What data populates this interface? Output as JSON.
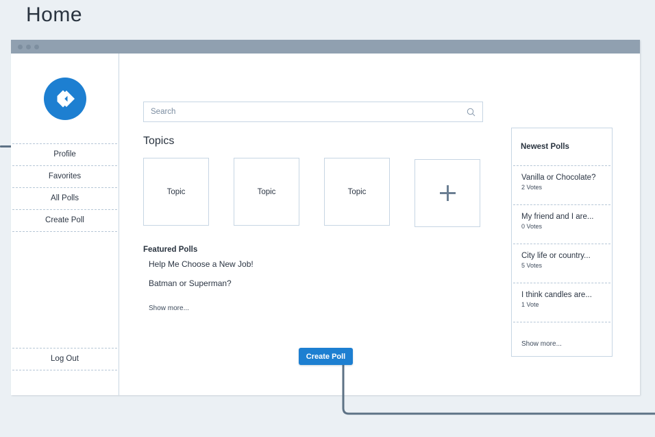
{
  "page": {
    "title": "Home",
    "background_color": "#ebf0f4",
    "accent_color": "#1d7fd1"
  },
  "window": {
    "titlebar": {
      "dots": [
        "window-dot-1",
        "window-dot-2",
        "window-dot-3"
      ],
      "color": "#90a0b0"
    }
  },
  "sidebar": {
    "logo": {
      "icon": "diamond-chevron-logo-icon",
      "color": "#1d7fd1"
    },
    "items": [
      {
        "label": "Profile",
        "name": "sidebar-item-profile"
      },
      {
        "label": "Favorites",
        "name": "sidebar-item-favorites"
      },
      {
        "label": "All Polls",
        "name": "sidebar-item-all-polls"
      },
      {
        "label": "Create Poll",
        "name": "sidebar-item-create-poll"
      }
    ],
    "logout": {
      "label": "Log Out"
    }
  },
  "search": {
    "value": "",
    "placeholder": "Search",
    "icon": "search-icon"
  },
  "topics": {
    "heading": "Topics",
    "cards": [
      {
        "label": "Topic"
      },
      {
        "label": "Topic"
      },
      {
        "label": "Topic"
      }
    ],
    "add_card": {
      "icon": "plus-icon",
      "label": ""
    }
  },
  "featured": {
    "heading": "Featured Polls",
    "items": [
      {
        "label": "Help Me Choose a New Job!"
      },
      {
        "label": "Batman or Superman?"
      }
    ],
    "show_more": "Show more..."
  },
  "newest_polls": {
    "heading": "Newest Polls",
    "items": [
      {
        "title": "Vanilla or Chocolate?",
        "votes": "2 Votes"
      },
      {
        "title": "My friend and I are...",
        "votes": "0 Votes"
      },
      {
        "title": "City life or country...",
        "votes": "5 Votes"
      },
      {
        "title": "I think candles are...",
        "votes": "1 Vote"
      }
    ],
    "show_more": "Show more..."
  },
  "create_poll_button": {
    "label": "Create Poll"
  }
}
